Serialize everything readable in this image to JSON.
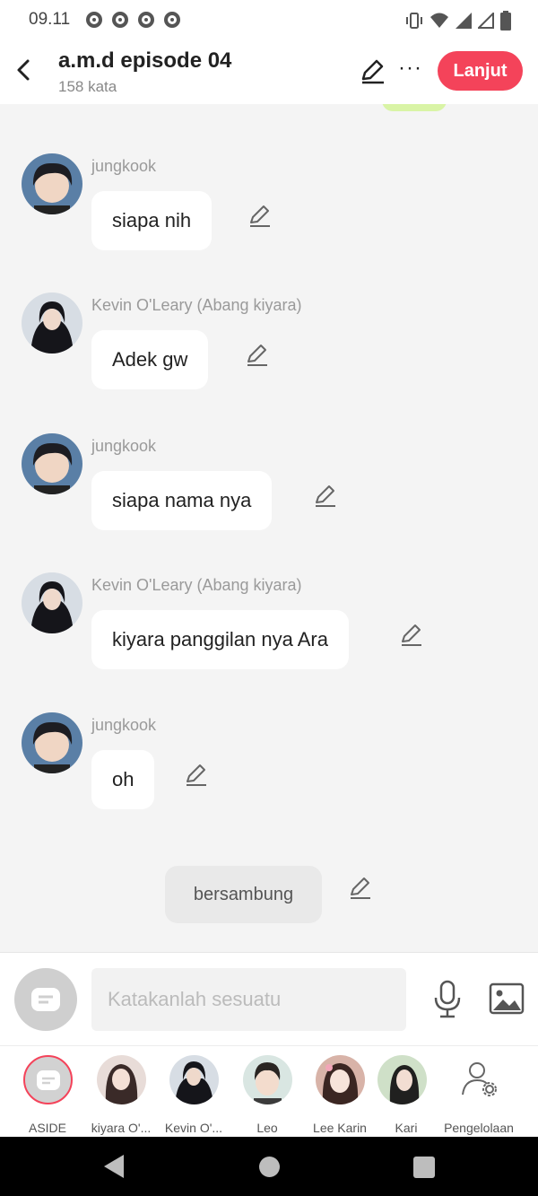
{
  "status_bar": {
    "time": "09.11"
  },
  "header": {
    "title": "a.m.d episode 04",
    "word_count": "158 kata",
    "next_button": "Lanjut"
  },
  "messages": [
    {
      "sender": "jungkook",
      "text": "siapa nih",
      "avatar": "jungkook-avatar"
    },
    {
      "sender": "Kevin O'Leary (Abang kiyara)",
      "text": "Adek gw",
      "avatar": "kevin-avatar"
    },
    {
      "sender": "jungkook",
      "text": "siapa nama nya",
      "avatar": "jungkook-avatar"
    },
    {
      "sender": "Kevin O'Leary (Abang kiyara)",
      "text": "kiyara panggilan nya Ara",
      "avatar": "kevin-avatar"
    },
    {
      "sender": "jungkook",
      "text": "oh",
      "avatar": "jungkook-avatar"
    }
  ],
  "narration": {
    "text": "bersambung"
  },
  "composer": {
    "placeholder": "Katakanlah sesuatu"
  },
  "characters": [
    {
      "name": "ASIDE"
    },
    {
      "name": "kiyara O'..."
    },
    {
      "name": "Kevin O'..."
    },
    {
      "name": "Leo"
    },
    {
      "name": "Lee Karin"
    },
    {
      "name": "Kari"
    }
  ],
  "manage_label": "Pengelolaan",
  "colors": {
    "accent": "#f4435a",
    "background": "#f4f4f4",
    "bubble": "#ffffff",
    "narration": "#e9e9e9"
  }
}
